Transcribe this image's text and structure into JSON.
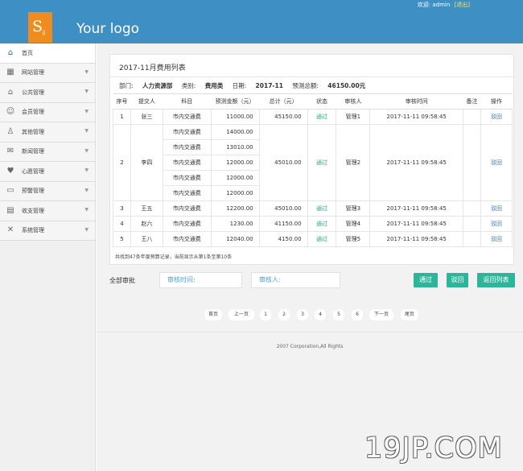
{
  "header": {
    "logo_letter": "S",
    "logo_sub": "jj",
    "logo_text": "Your logo",
    "welcome": "欢迎:",
    "user": "admin",
    "logout": "[退出]"
  },
  "sidebar": {
    "items": [
      {
        "label": "首页",
        "icon": "home-icon",
        "active": true
      },
      {
        "label": "网站管理",
        "icon": "grid-icon"
      },
      {
        "label": "公共管理",
        "icon": "house-icon"
      },
      {
        "label": "会员管理",
        "icon": "user-icon"
      },
      {
        "label": "其他管理",
        "icon": "person-icon"
      },
      {
        "label": "新闻管理",
        "icon": "chat-icon"
      },
      {
        "label": "心愿管理",
        "icon": "heart-icon"
      },
      {
        "label": "预警管理",
        "icon": "monitor-icon"
      },
      {
        "label": "收支管理",
        "icon": "folder-icon"
      },
      {
        "label": "系统管理",
        "icon": "tools-icon"
      }
    ]
  },
  "panel": {
    "title": "2017-11月费用列表",
    "dept_label": "部门:",
    "dept": "人力资源部",
    "type_label": "类别:",
    "type": "费用类",
    "date_label": "日期:",
    "date": "2017-11",
    "budget_label": "预测总额:",
    "budget": "46150.00元"
  },
  "table": {
    "headers": [
      "序号",
      "提交人",
      "科目",
      "预测金额（元）",
      "总计（元）",
      "状态",
      "审核人",
      "审核时间",
      "备注",
      "操作"
    ],
    "rows": [
      {
        "no": "1",
        "submitter": "张三",
        "items": [
          {
            "subject": "市内交通费",
            "amount": "11000.00"
          }
        ],
        "total": "45150.00",
        "status": "通过",
        "reviewer": "管理1",
        "time": "2017-11-11 09:58:45",
        "note": "",
        "action": "驳回"
      },
      {
        "no": "2",
        "submitter": "李四",
        "items": [
          {
            "subject": "市内交通费",
            "amount": "14000.00"
          },
          {
            "subject": "市内交通费",
            "amount": "13010.00"
          },
          {
            "subject": "市内交通费",
            "amount": "12000.00"
          },
          {
            "subject": "市内交通费",
            "amount": "12000.00"
          },
          {
            "subject": "市内交通费",
            "amount": "12000.00"
          }
        ],
        "total": "45010.00",
        "status": "通过",
        "reviewer": "管理2",
        "time": "2017-11-11 09:58:45",
        "note": "",
        "action": "驳回"
      },
      {
        "no": "3",
        "submitter": "王五",
        "items": [
          {
            "subject": "市内交通费",
            "amount": "12200.00"
          }
        ],
        "total": "45010.00",
        "status": "通过",
        "reviewer": "管理3",
        "time": "2017-11-11 09:58:45",
        "note": "",
        "action": "驳回"
      },
      {
        "no": "4",
        "submitter": "赵六",
        "items": [
          {
            "subject": "市内交通费",
            "amount": "1230.00"
          }
        ],
        "total": "41150.00",
        "status": "通过",
        "reviewer": "管理4",
        "time": "2017-11-11 09:58:45",
        "note": "",
        "action": "驳回"
      },
      {
        "no": "5",
        "submitter": "王八",
        "items": [
          {
            "subject": "市内交通费",
            "amount": "12040.00"
          }
        ],
        "total": "4150.00",
        "status": "通过",
        "reviewer": "管理5",
        "time": "2017-11-11 09:58:45",
        "note": "",
        "action": "驳回"
      }
    ],
    "footnote": "共找到47条年度预算记录，当前显示从第1条至第10条"
  },
  "batch": {
    "label": "全部审批",
    "review_time_placeholder": "审核时间:",
    "reviewer_placeholder": "审核人:",
    "approve": "通过",
    "reject": "驳回",
    "back": "返回列表"
  },
  "pager": {
    "first": "首页",
    "prev": "上一页",
    "pages": [
      "1",
      "2",
      "3",
      "4",
      "5",
      "6"
    ],
    "next": "下一页",
    "last": "尾页"
  },
  "footer": {
    "copyright": "2007 Corporation,All Rights"
  },
  "watermark": "19JP.COM",
  "colors": {
    "header_bg": "#3d8fc4",
    "logo_bg": "#f08c1e",
    "accent_green": "#2cb59a",
    "link_blue": "#3b7bbf"
  }
}
